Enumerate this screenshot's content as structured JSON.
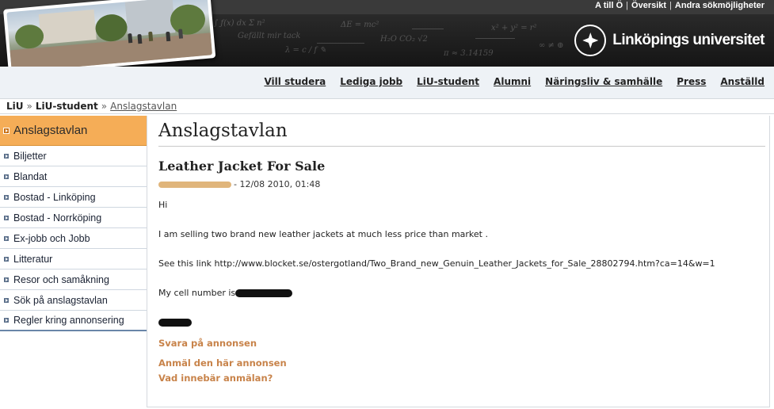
{
  "top_links": [
    "A till Ö",
    "Översikt",
    "Andra sökmöjligheter"
  ],
  "logo": {
    "text": "Linköpings universitet"
  },
  "main_nav": [
    "Vill studera",
    "Lediga jobb",
    "LiU-student",
    "Alumni",
    "Näringsliv & samhälle",
    "Press",
    "Anställd"
  ],
  "breadcrumb": {
    "items": [
      "LiU",
      "LiU-student"
    ],
    "separator": "»",
    "current": "Anslagstavlan"
  },
  "sidebar": {
    "heading": "Anslagstavlan",
    "items": [
      "Biljetter",
      "Blandat",
      "Bostad - Linköping",
      "Bostad - Norrköping",
      "Ex-jobb och Jobb",
      "Litteratur",
      "Resor och samåkning",
      "Sök på anslagstavlan",
      "Regler kring annonsering"
    ]
  },
  "content": {
    "page_title": "Anslagstavlan",
    "post_title": "Leather Jacket For Sale",
    "post_meta": "- 12/08 2010, 01:48",
    "greeting": "Hi",
    "body_1": "I am selling two brand new leather jackets at much less price than market .",
    "body_2": "See this link http://www.blocket.se/ostergotland/Two_Brand_new_Genuin_Leather_Jackets_for_Sale_28802794.htm?ca=14&w=1",
    "body_3": "My cell number is",
    "actions": [
      "Svara på annonsen",
      "Anmäl den här annonsen",
      "Vad innebär anmälan?"
    ]
  },
  "colors": {
    "sidebar_active": "#f5ad57",
    "link_action": "#c8834a",
    "top_bar": "#3a3a3a"
  }
}
